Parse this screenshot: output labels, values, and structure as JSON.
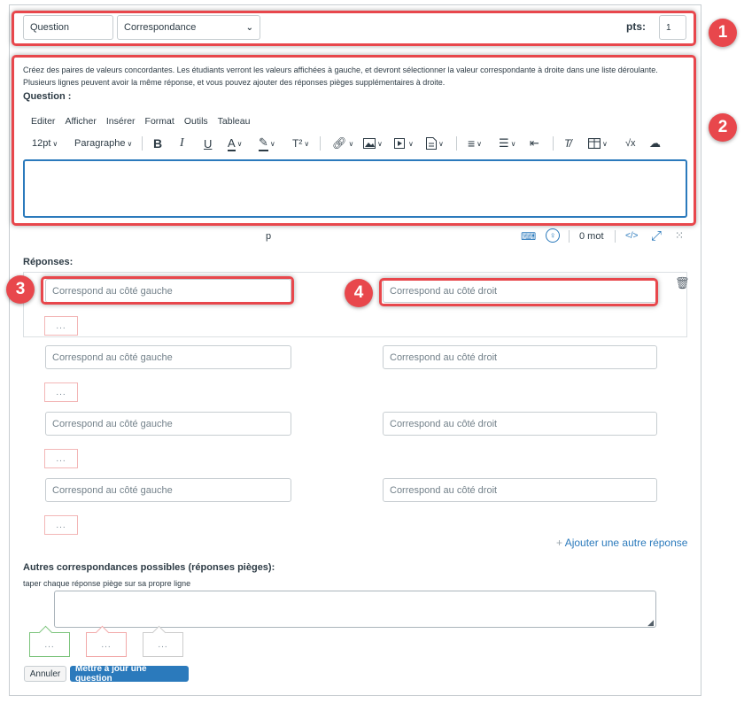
{
  "header": {
    "question_name": "Question",
    "question_type": "Correspondance",
    "points_label": "pts:",
    "points_value": "1"
  },
  "instructions": {
    "line1": "Créez des paires de valeurs concordantes. Les étudiants verront les valeurs affichées à gauche, et devront sélectionner la valeur correspondante à droite dans une liste déroulante.",
    "line2": "Plusieurs lignes peuvent avoir la même réponse, et vous pouvez ajouter des réponses pièges supplémentaires à droite.",
    "question_label": "Question :"
  },
  "editor": {
    "menu": [
      "Editer",
      "Afficher",
      "Insérer",
      "Format",
      "Outils",
      "Tableau"
    ],
    "font_size": "12pt",
    "block_format": "Paragraphe",
    "status_path": "p",
    "word_count": "0 mot",
    "html_toggle": "</>"
  },
  "answers": {
    "label": "Réponses:",
    "left_placeholder": "Correspond au côté gauche",
    "right_placeholder": "Correspond au côté droit",
    "more": "...",
    "add_label": "Ajouter une autre réponse"
  },
  "distractors": {
    "label": "Autres correspondances possibles (réponses pièges):",
    "hint": "taper chaque réponse piège sur sa propre ligne",
    "bubble": "..."
  },
  "buttons": {
    "cancel": "Annuler",
    "update": "Mettre à jour une question"
  },
  "badges": [
    "1",
    "2",
    "3",
    "4"
  ],
  "colors": {
    "highlight": "#e8474c",
    "link": "#2b7abc",
    "primary_button": "#2b7abc"
  }
}
